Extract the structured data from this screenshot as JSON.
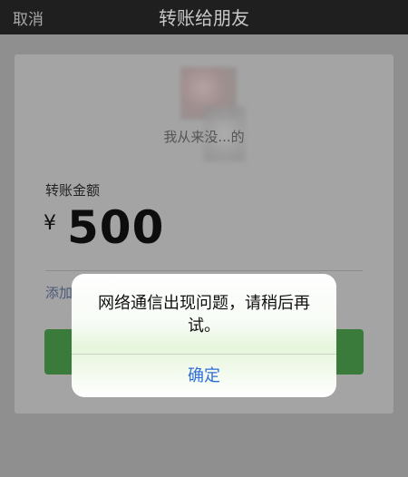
{
  "nav": {
    "cancel_label": "取消",
    "title": "转账给朋友"
  },
  "recipient": {
    "name": "我从来没...的"
  },
  "transfer": {
    "amount_label": "转账金额",
    "currency_symbol": "¥",
    "amount": "500",
    "add_note_label": "添加"
  },
  "dialog": {
    "message": "网络通信出现问题，请稍后再试。",
    "ok_label": "确定"
  },
  "colors": {
    "dialog_ok": "#2f6fd6",
    "confirm_button": "#3a7a3a"
  }
}
